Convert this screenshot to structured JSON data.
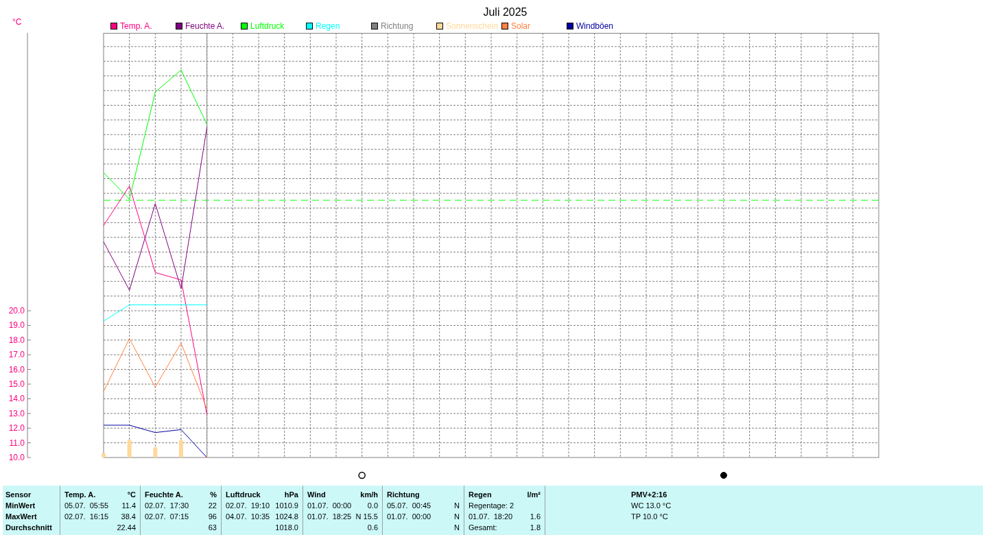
{
  "chart": {
    "title": "Juli 2025",
    "unit": "°C",
    "legend": [
      {
        "label": "Temp. A.",
        "color": "#ff0080"
      },
      {
        "label": "Feuchte A.",
        "color": "#800080"
      },
      {
        "label": "Luftdruck",
        "color": "#00ff00"
      },
      {
        "label": "Regen",
        "color": "#00ffff"
      },
      {
        "label": "Richtung",
        "color": "#808080"
      },
      {
        "label": "Sonnenschein",
        "color": "#ffd89a"
      },
      {
        "label": "Solar",
        "color": "#ff8040"
      },
      {
        "label": "Windböen",
        "color": "#0000a0"
      }
    ],
    "y_axis_labels": [
      "20.0",
      "19.0",
      "18.0",
      "17.0",
      "16.0",
      "15.0",
      "14.0",
      "13.0",
      "12.0",
      "11.0",
      "10.0"
    ]
  },
  "stats": {
    "columns": [
      {
        "kind": "label",
        "cells": [
          "Sensor",
          "MinWert",
          "MaxWert",
          "Durchschnitt"
        ]
      },
      {
        "kind": "sensor",
        "title": "Temp. A.",
        "unit": "°C",
        "rows": [
          {
            "time": "05.07.  05:55",
            "value": "11.4"
          },
          {
            "time": "02.07.  16:15",
            "value": "38.4"
          },
          {
            "value": "22.44"
          }
        ]
      },
      {
        "kind": "sensor",
        "title": "Feuchte A.",
        "unit": "%",
        "rows": [
          {
            "time": "02.07.  17:30",
            "value": "22"
          },
          {
            "time": "02.07.  07:15",
            "value": "96"
          },
          {
            "value": "63"
          }
        ]
      },
      {
        "kind": "sensor",
        "title": "Luftdruck",
        "unit": "hPa",
        "rows": [
          {
            "time": "02.07.  19:10",
            "value": "1010.9"
          },
          {
            "time": "04.07.  10:35",
            "value": "1024.8"
          },
          {
            "value": "1018.0"
          }
        ]
      },
      {
        "kind": "sensor",
        "title": "Wind",
        "unit": "km/h",
        "rows": [
          {
            "time": "01.07.  00:00",
            "value": "0.0"
          },
          {
            "time": "01.07.  18:25",
            "value": "N 15.5"
          },
          {
            "value": "0.6"
          }
        ]
      },
      {
        "kind": "sensor",
        "title": "Richtung",
        "rows": [
          {
            "time": "05.07.  00:45",
            "value": "N"
          },
          {
            "time": "01.07.  00:00",
            "value": "N"
          },
          {
            "value": "N"
          }
        ]
      },
      {
        "kind": "sensor",
        "title": "Regen",
        "unit": "l/m²",
        "rows": [
          {
            "time": "Regentage: 2"
          },
          {
            "time": "01.07.  18:20",
            "value": "1.6"
          },
          {
            "time": "Gesamt:",
            "value": "1.8"
          }
        ]
      },
      {
        "kind": "note",
        "cells": [
          "PMV+2:16",
          "WC 13.0 °C",
          "TP 10.0 °C"
        ]
      }
    ]
  }
}
